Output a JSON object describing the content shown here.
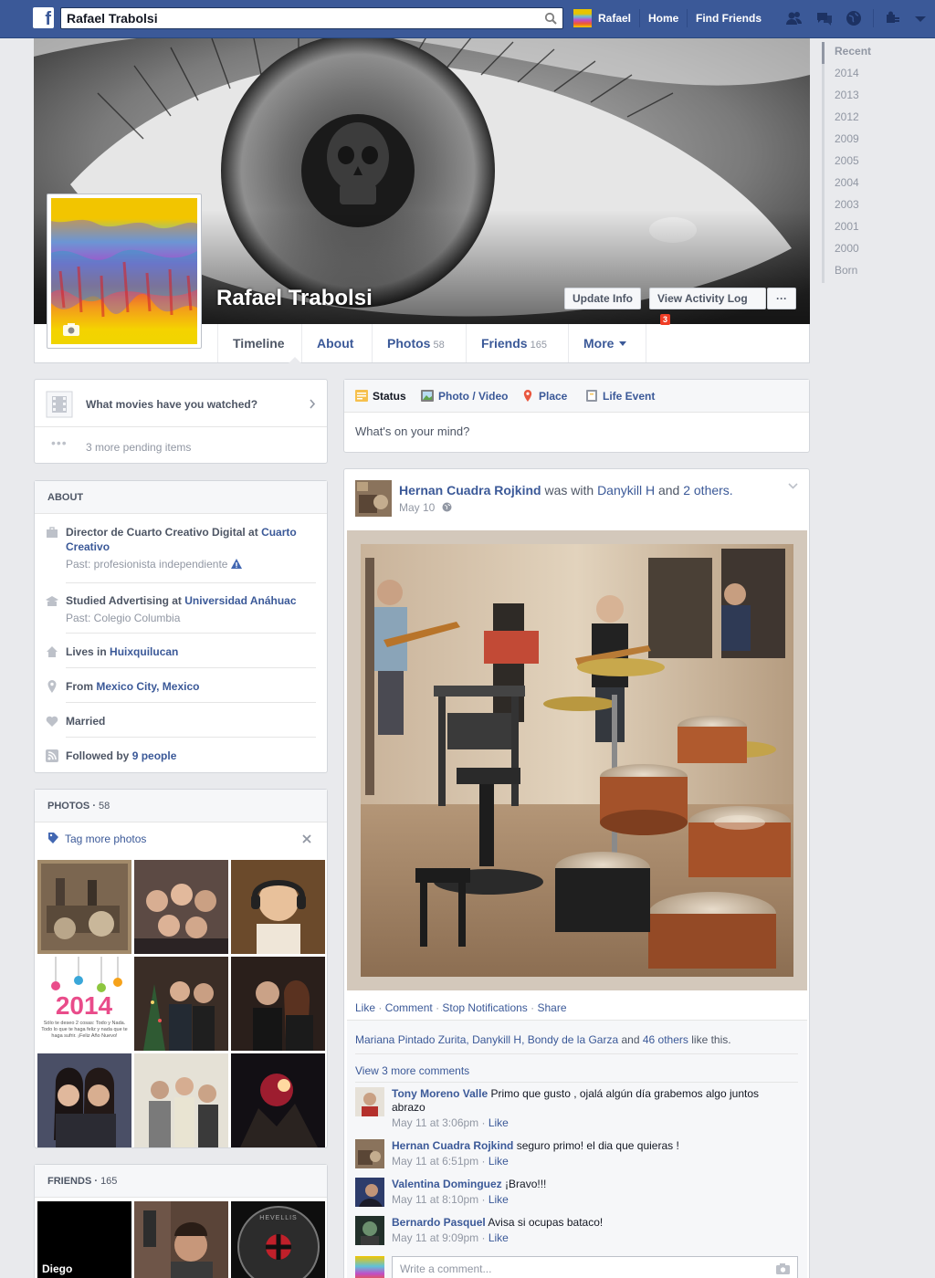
{
  "topbar": {
    "search_value": "Rafael Trabolsi",
    "user_name": "Rafael",
    "home": "Home",
    "find_friends": "Find Friends"
  },
  "profile": {
    "name": "Rafael Trabolsi",
    "update_info": "Update Info",
    "activity_log": "View Activity Log",
    "activity_count": "3",
    "more_dots": "···"
  },
  "tabs": [
    {
      "label": "Timeline",
      "count": ""
    },
    {
      "label": "About",
      "count": ""
    },
    {
      "label": "Photos",
      "count": "58"
    },
    {
      "label": "Friends",
      "count": "165"
    },
    {
      "label": "More",
      "count": ""
    }
  ],
  "years": [
    "Recent",
    "2014",
    "2013",
    "2012",
    "2009",
    "2005",
    "2004",
    "2003",
    "2001",
    "2000",
    "Born"
  ],
  "pending": {
    "question": "What movies have you watched?",
    "more": "3 more pending items"
  },
  "about": {
    "title": "ABOUT",
    "work_prefix": "Director de Cuarto Creativo Digital at",
    "work_link": "Cuarto Creativo",
    "work_past": "Past: profesionista independiente",
    "edu_prefix": "Studied Advertising at",
    "edu_link": "Universidad Anáhuac",
    "edu_past": "Past: Colegio Columbia",
    "lives_prefix": "Lives in",
    "lives_link": "Huixquilucan",
    "from_prefix": "From",
    "from_link": "Mexico City, Mexico",
    "married": "Married",
    "followed_prefix": "Followed by",
    "followed_link": "9 people"
  },
  "photos_box": {
    "title": "PHOTOS",
    "count": "58",
    "tag_more": "Tag more photos",
    "new_year_text": "2014",
    "new_year_card": "Sólo te deseo 2 cosas: Todo y Nada. Todo lo que te haga feliz y nada que te haga sufrir. ¡Feliz Año Nuevo!"
  },
  "friends_box": {
    "title": "FRIENDS",
    "count": "165",
    "first_friend": "Diego",
    "third_friend_art": "HEVELLIS"
  },
  "composer": {
    "status": "Status",
    "photo_video": "Photo / Video",
    "place": "Place",
    "life_event": "Life Event",
    "placeholder": "What's on your mind?"
  },
  "post": {
    "author": "Hernan Cuadra Rojkind",
    "with_text": "was with",
    "tagged": "Danykill H",
    "and_text": "and",
    "others": "2 others.",
    "date": "May 10",
    "actions": [
      "Like",
      "Comment",
      "Stop Notifications",
      "Share"
    ],
    "likes_names": "Mariana Pintado Zurita, Danykill H, Bondy de la Garza",
    "likes_and": "and",
    "likes_others": "46 others",
    "likes_suffix": "like this.",
    "view_comments": "View 3 more comments",
    "comments": [
      {
        "name": "Tony Moreno Valle",
        "text": "Primo que gusto , ojalá algún día grabemos algo juntos abrazo",
        "time": "May 11 at 3:06pm",
        "like": "Like"
      },
      {
        "name": "Hernan Cuadra Rojkind",
        "text": "seguro primo! el dia que quieras !",
        "time": "May 11 at 6:51pm",
        "like": "Like"
      },
      {
        "name": "Valentina Dominguez",
        "text": "¡Bravo!!!",
        "time": "May 11 at 8:10pm",
        "like": "Like"
      },
      {
        "name": "Bernardo Pasquel",
        "text": "Avisa si ocupas bataco!",
        "time": "May 11 at 9:09pm",
        "like": "Like"
      }
    ],
    "write_comment": "Write a comment..."
  },
  "colors": {
    "brand": "#3b5998",
    "background": "#e9eaed",
    "badge": "#f03d25"
  }
}
